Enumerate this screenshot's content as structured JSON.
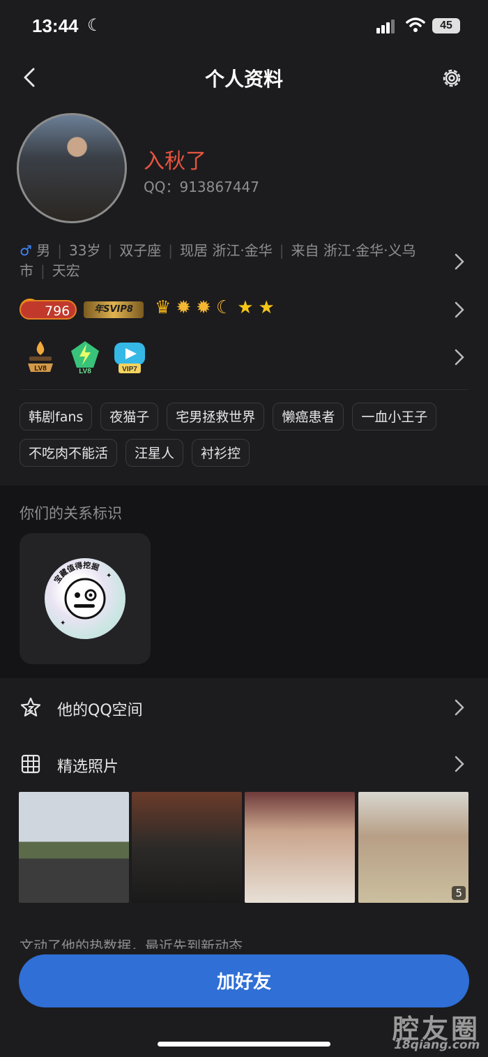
{
  "status_bar": {
    "time": "13:44",
    "battery": "45"
  },
  "nav": {
    "title": "个人资料"
  },
  "profile": {
    "nickname": "入秋了",
    "qq_label": "QQ：913867447",
    "gender_symbol": "♂",
    "gender": "男",
    "age": "33岁",
    "zodiac": "双子座",
    "current_city": "现居 浙江·金华",
    "hometown": "来自 浙江·金华·义乌市",
    "company": "天宏"
  },
  "badges": {
    "coins": "796",
    "svip": "年SVIP8",
    "levels": [
      "LV8",
      "LV8",
      "VIP7"
    ]
  },
  "tags": [
    "韩剧fans",
    "夜猫子",
    "宅男拯救世界",
    "懒癌患者",
    "一血小王子",
    "不吃肉不能活",
    "汪星人",
    "衬衫控"
  ],
  "relation": {
    "title": "你们的关系标识",
    "badge_text": "宝藏值得挖掘"
  },
  "menu": {
    "qzone": "他的QQ空间",
    "photos": "精选照片",
    "photo_count": "5",
    "peek_text": "文动了他的热数据，最近先到新动态"
  },
  "actions": {
    "add_friend": "加好友"
  },
  "watermark": {
    "line1": "腔友圈",
    "line2": "18qiang.com"
  },
  "colors": {
    "accent_blue": "#2f6fd6",
    "nickname": "#e8553f",
    "background": "#1c1c1e"
  }
}
